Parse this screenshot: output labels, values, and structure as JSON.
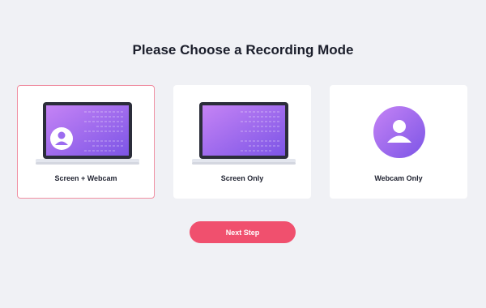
{
  "page": {
    "title": "Please Choose a Recording Mode"
  },
  "modes": [
    {
      "label": "Screen + Webcam",
      "icon": "laptop-with-user-icon",
      "selected": true
    },
    {
      "label": "Screen Only",
      "icon": "laptop-icon",
      "selected": false
    },
    {
      "label": "Webcam Only",
      "icon": "user-circle-icon",
      "selected": false
    }
  ],
  "actions": {
    "next_label": "Next Step"
  },
  "colors": {
    "accent": "#f0506e",
    "selected_border": "#f08fa2",
    "screen_gradient_start": "#c583f5",
    "screen_gradient_end": "#7c55e6",
    "background": "#f0f1f5"
  }
}
